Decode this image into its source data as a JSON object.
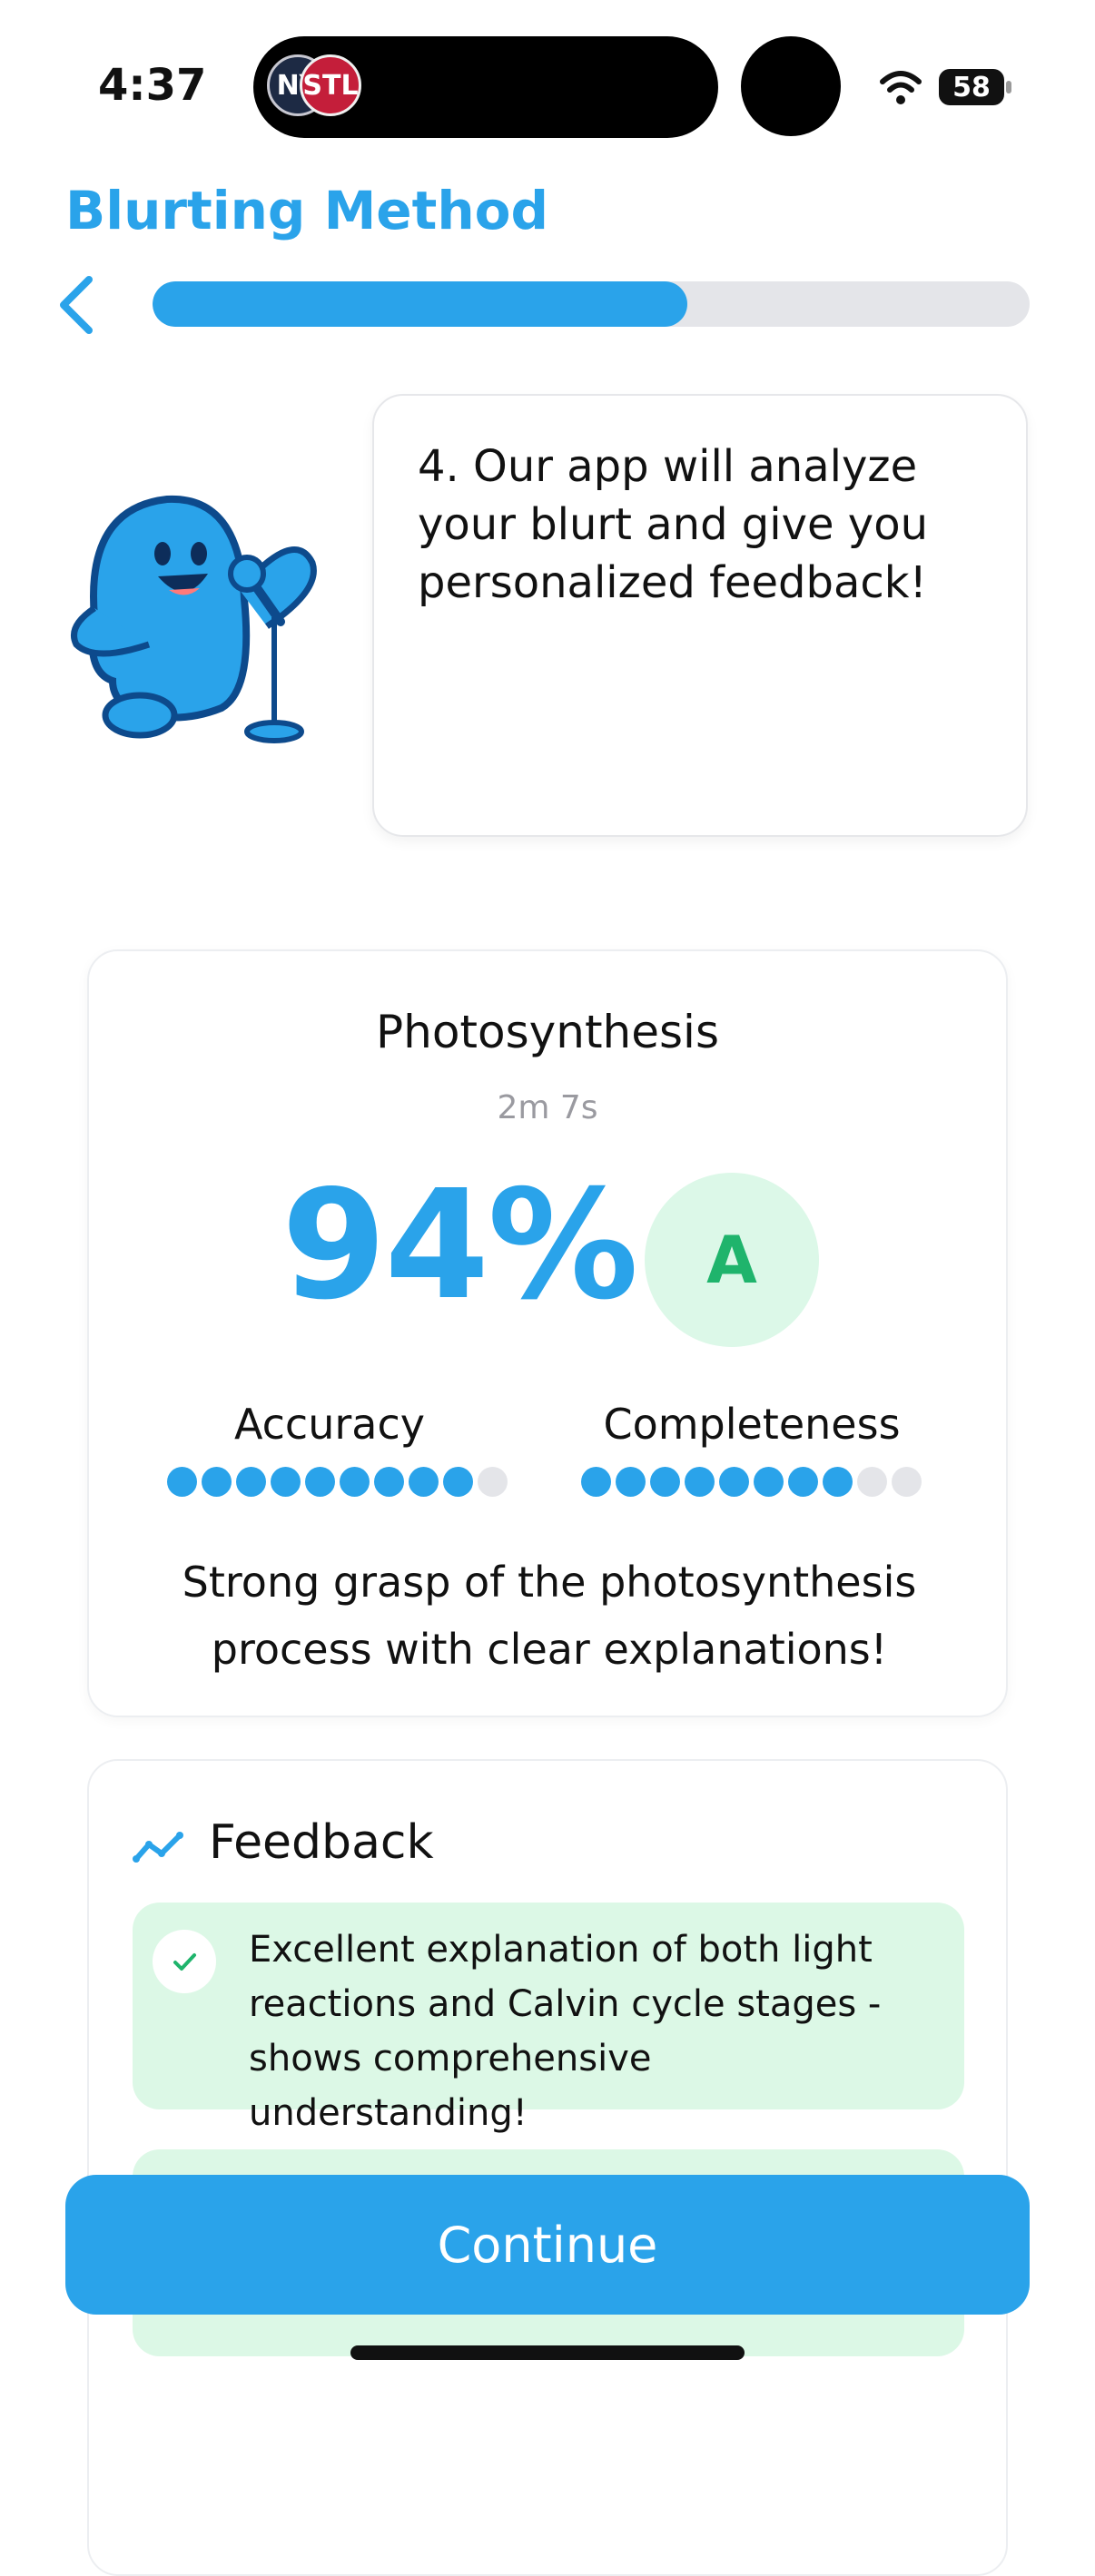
{
  "status_bar": {
    "time": "4:37",
    "battery": "58",
    "teams": [
      "NY",
      "STL"
    ]
  },
  "header": {
    "title": "Blurting Method",
    "progress": 0.61
  },
  "speech": {
    "text": "4. Our app will analyze your blurt and give you personalized feedback!"
  },
  "mascot": {
    "icon": "mascot-with-microphone-icon",
    "color": "#2aa3ea"
  },
  "result": {
    "topic": "Photosynthesis",
    "time": "2m 7s",
    "score": "94%",
    "grade": "A",
    "accuracy": {
      "label": "Accuracy",
      "filled": 9,
      "total": 10
    },
    "completeness": {
      "label": "Completeness",
      "filled": 8,
      "total": 10
    },
    "summary": "Strong grasp of the photosynthesis process with clear explanations!"
  },
  "feedback": {
    "title": "Feedback",
    "items": [
      {
        "text": "Excellent explanation of both light reactions and Calvin cycle stages - shows comprehensive understanding!",
        "icon": "check-icon"
      }
    ]
  },
  "continue_label": "Continue",
  "colors": {
    "accent": "#2aa3ea",
    "success_bg": "#dcf8e6",
    "grade_text": "#1fb46c"
  }
}
